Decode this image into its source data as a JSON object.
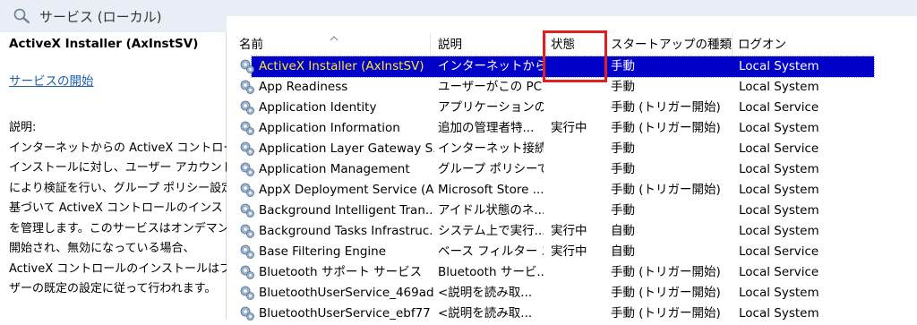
{
  "window": {
    "title": "サービス (ローカル)"
  },
  "left": {
    "service_name": "ActiveX Installer (AxInstSV)",
    "start_link": "サービスの開始",
    "desc_lines": [
      "説明:",
      "インターネットからの ActiveX コントロールの",
      "インストールに対し、ユーザー アカウント制御",
      "により検証を行い、グループ ポリシー設定に",
      "基づいて ActiveX コントロールのインストール",
      "を管理します。このサービスはオンデマンドで",
      "開始され、無効になっている場合、",
      "ActiveX コントロールのインストールはブラウ",
      "ザーの既定の設定に従って行われます。"
    ]
  },
  "columns": {
    "name": "名前",
    "desc": "説明",
    "status": "状態",
    "startup": "スタートアップの種類",
    "logon": "ログオン"
  },
  "rows": [
    {
      "name": "ActiveX Installer (AxInstSV)",
      "desc": "インターネットから...",
      "status": "",
      "startup": "手動",
      "logon": "Local System"
    },
    {
      "name": "App Readiness",
      "desc": "ユーザーがこの PC ...",
      "status": "",
      "startup": "手動",
      "logon": "Local System"
    },
    {
      "name": "Application Identity",
      "desc": "アプリケーションの I...",
      "status": "",
      "startup": "手動 (トリガー開始)",
      "logon": "Local Service"
    },
    {
      "name": "Application Information",
      "desc": "追加の管理者特...",
      "status": "実行中",
      "startup": "手動 (トリガー開始)",
      "logon": "Local System"
    },
    {
      "name": "Application Layer Gateway S...",
      "desc": "インターネット接続...",
      "status": "",
      "startup": "手動",
      "logon": "Local Service"
    },
    {
      "name": "Application Management",
      "desc": "グループ ポリシーで...",
      "status": "",
      "startup": "手動",
      "logon": "Local System"
    },
    {
      "name": "AppX Deployment Service (A...",
      "desc": "Microsoft Store ...",
      "status": "",
      "startup": "手動 (トリガー開始)",
      "logon": "Local System"
    },
    {
      "name": "Background Intelligent Tran...",
      "desc": "アイドル状態のネ...",
      "status": "",
      "startup": "手動",
      "logon": "Local System"
    },
    {
      "name": "Background Tasks Infrastruc...",
      "desc": "システム上で実行...",
      "status": "実行中",
      "startup": "自動",
      "logon": "Local System"
    },
    {
      "name": "Base Filtering Engine",
      "desc": "ベース フィルター エ...",
      "status": "実行中",
      "startup": "自動",
      "logon": "Local Service"
    },
    {
      "name": "Bluetooth サポート サービス",
      "desc": "Bluetooth サービ...",
      "status": "",
      "startup": "手動 (トリガー開始)",
      "logon": "Local Service"
    },
    {
      "name": "BluetoothUserService_469ad",
      "desc": "<説明を読み取...",
      "status": "",
      "startup": "手動 (トリガー開始)",
      "logon": "Local System"
    },
    {
      "name": "BluetoothUserService_ebf77",
      "desc": "<説明を読み取...",
      "status": "",
      "startup": "手動 (トリガー開始)",
      "logon": "Local System"
    }
  ],
  "colors": {
    "selection": "#0000c8",
    "selected_name": "#ffe633",
    "highlight_box": "#e02020",
    "link": "#1a5fb4"
  }
}
